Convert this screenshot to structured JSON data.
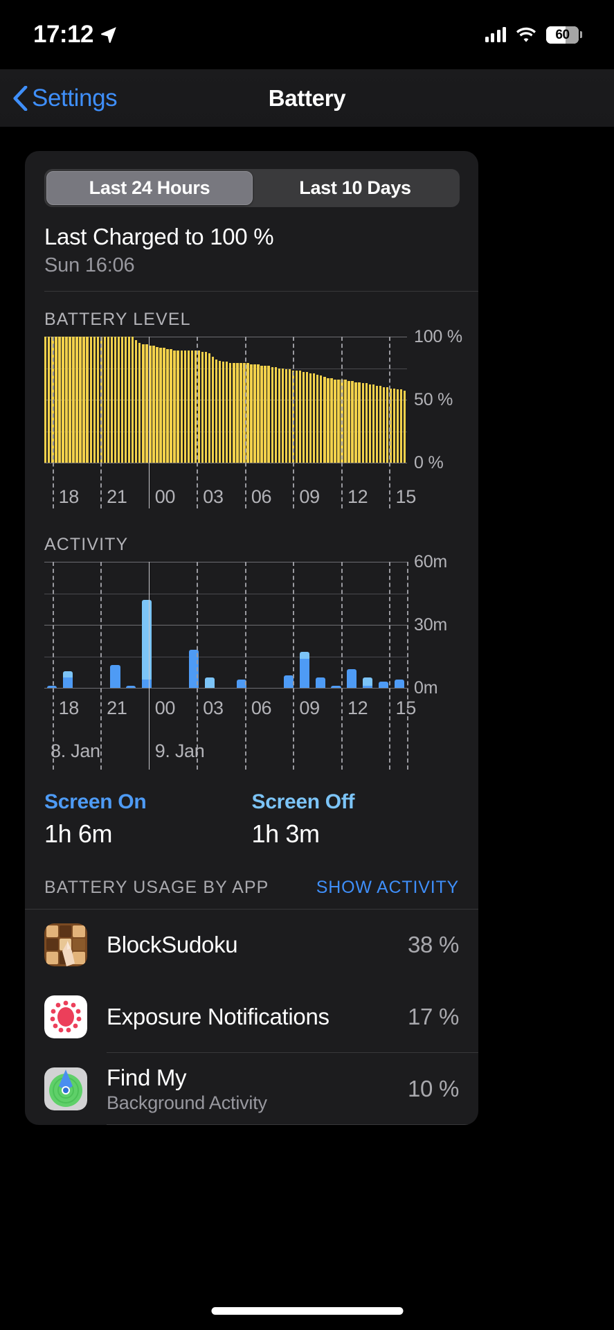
{
  "status_bar": {
    "time": "17:12",
    "location_icon": "location-arrow-icon",
    "cellular_icon": "cellular-bars-icon",
    "wifi_icon": "wifi-icon",
    "battery_percent": "60",
    "battery_level": 60
  },
  "nav": {
    "back_label": "Settings",
    "back_icon": "chevron-left-icon",
    "title": "Battery"
  },
  "segmented": {
    "options": [
      "Last 24 Hours",
      "Last 10 Days"
    ],
    "selected_index": 0
  },
  "last_charged": {
    "title": "Last Charged to 100 %",
    "subtitle": "Sun 16:06"
  },
  "chart_data": [
    {
      "type": "bar",
      "title": "BATTERY LEVEL",
      "xlabel": "",
      "ylabel": "",
      "ylim": [
        0,
        100
      ],
      "ytick_labels": [
        "100 %",
        "50 %",
        "0 %"
      ],
      "yticks": [
        100,
        50,
        0
      ],
      "gridlines": [
        100,
        75,
        50,
        25,
        0
      ],
      "x_tick_labels": [
        "18",
        "21",
        "00",
        "03",
        "06",
        "09",
        "12",
        "15"
      ],
      "x_tick_hours": [
        18,
        21,
        0,
        3,
        6,
        9,
        12,
        15
      ],
      "grid": true,
      "legend": "none",
      "color": "#f2d14b",
      "values": [
        100,
        100,
        100,
        100,
        100,
        100,
        100,
        100,
        100,
        100,
        100,
        100,
        100,
        100,
        100,
        100,
        100,
        100,
        100,
        100,
        100,
        100,
        100,
        100,
        100,
        100,
        97,
        95,
        94,
        94,
        93,
        93,
        92,
        91,
        91,
        90,
        90,
        89,
        89,
        89,
        89,
        89,
        89,
        89,
        89,
        88,
        88,
        87,
        84,
        82,
        81,
        80,
        80,
        79,
        79,
        79,
        79,
        79,
        79,
        78,
        78,
        78,
        77,
        77,
        77,
        76,
        76,
        75,
        75,
        74,
        74,
        73,
        73,
        73,
        72,
        72,
        71,
        71,
        70,
        69,
        68,
        67,
        67,
        66,
        66,
        66,
        66,
        65,
        65,
        64,
        64,
        63,
        63,
        62,
        62,
        61,
        61,
        60,
        60,
        59,
        59,
        58,
        58,
        57
      ]
    },
    {
      "type": "bar",
      "title": "ACTIVITY",
      "stacked": true,
      "xlabel": "",
      "ylabel": "",
      "ylim": [
        0,
        60
      ],
      "ytick_labels": [
        "60m",
        "30m",
        "0m"
      ],
      "yticks": [
        60,
        30,
        0
      ],
      "gridlines": [
        60,
        45,
        30,
        15,
        0
      ],
      "x_tick_labels": [
        "18",
        "21",
        "00",
        "03",
        "06",
        "09",
        "12",
        "15"
      ],
      "day_labels": [
        "8. Jan",
        "9. Jan"
      ],
      "grid": true,
      "series": [
        {
          "name": "Screen On",
          "color": "#4e9bf5",
          "values": [
            1,
            5,
            0,
            0,
            11,
            1,
            4,
            0,
            0,
            18,
            0,
            0,
            4,
            0,
            0,
            6,
            14,
            5,
            1,
            9,
            1,
            3,
            4
          ]
        },
        {
          "name": "Screen Off",
          "color": "#7cc4f7",
          "values": [
            0,
            3,
            0,
            0,
            0,
            0,
            38,
            0,
            0,
            0,
            5,
            0,
            0,
            0,
            0,
            0,
            3,
            0,
            0,
            0,
            4,
            0,
            0
          ]
        }
      ]
    }
  ],
  "screen_summary": {
    "on_label": "Screen On",
    "on_value": "1h 6m",
    "off_label": "Screen Off",
    "off_value": "1h 3m",
    "on_color": "#4e9bf5",
    "off_color": "#7cc4f7"
  },
  "usage_header": {
    "title": "BATTERY USAGE BY APP",
    "action": "SHOW ACTIVITY"
  },
  "apps": [
    {
      "name": "BlockSudoku",
      "subtitle": "",
      "percent": "38 %",
      "icon": "blocksudoku-app-icon"
    },
    {
      "name": "Exposure Notifications",
      "subtitle": "",
      "percent": "17 %",
      "icon": "exposure-notifications-app-icon"
    },
    {
      "name": "Find My",
      "subtitle": "Background Activity",
      "percent": "10 %",
      "icon": "find-my-app-icon"
    }
  ]
}
